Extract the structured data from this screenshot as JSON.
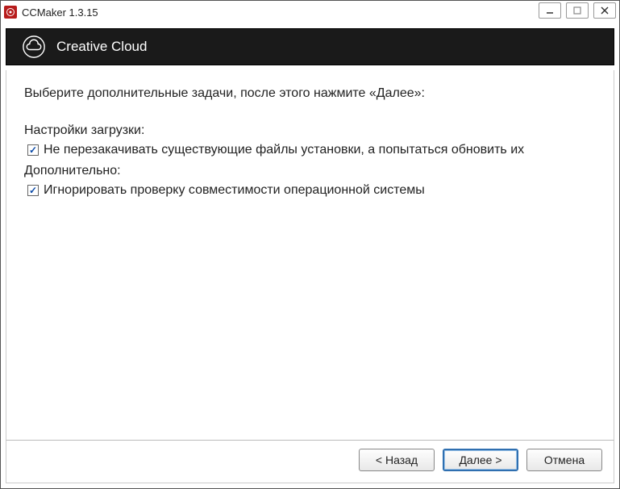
{
  "title": "CCMaker 1.3.15",
  "banner": {
    "title": "Creative Cloud"
  },
  "page": {
    "instruction": "Выберите дополнительные задачи, после этого нажмите «Далее»:",
    "section1_label": "Настройки загрузки:",
    "check1_label": "Не перезакачивать существующие файлы установки, а попытаться обновить их",
    "section2_label": "Дополнительно:",
    "check2_label": "Игнорировать проверку совместимости операционной системы"
  },
  "buttons": {
    "back": "< Назад",
    "next": "Далее >",
    "cancel": "Отмена"
  }
}
